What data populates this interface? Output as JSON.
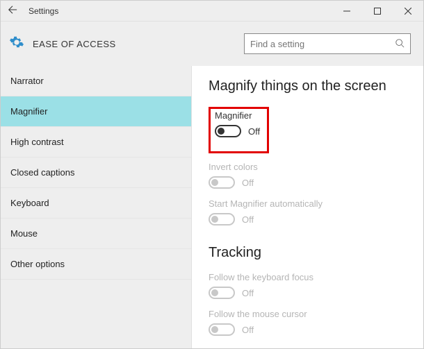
{
  "window": {
    "title": "Settings"
  },
  "header": {
    "breadcrumb": "EASE OF ACCESS",
    "search_placeholder": "Find a setting"
  },
  "sidebar": {
    "items": [
      {
        "label": "Narrator"
      },
      {
        "label": "Magnifier"
      },
      {
        "label": "High contrast"
      },
      {
        "label": "Closed captions"
      },
      {
        "label": "Keyboard"
      },
      {
        "label": "Mouse"
      },
      {
        "label": "Other options"
      }
    ],
    "selected_index": 1
  },
  "content": {
    "section1_title": "Magnify things on the screen",
    "settings1": [
      {
        "label": "Magnifier",
        "state": "Off",
        "enabled": true
      },
      {
        "label": "Invert colors",
        "state": "Off",
        "enabled": false
      },
      {
        "label": "Start Magnifier automatically",
        "state": "Off",
        "enabled": false
      }
    ],
    "section2_title": "Tracking",
    "settings2": [
      {
        "label": "Follow the keyboard focus",
        "state": "Off",
        "enabled": false
      },
      {
        "label": "Follow the mouse cursor",
        "state": "Off",
        "enabled": false
      }
    ]
  }
}
